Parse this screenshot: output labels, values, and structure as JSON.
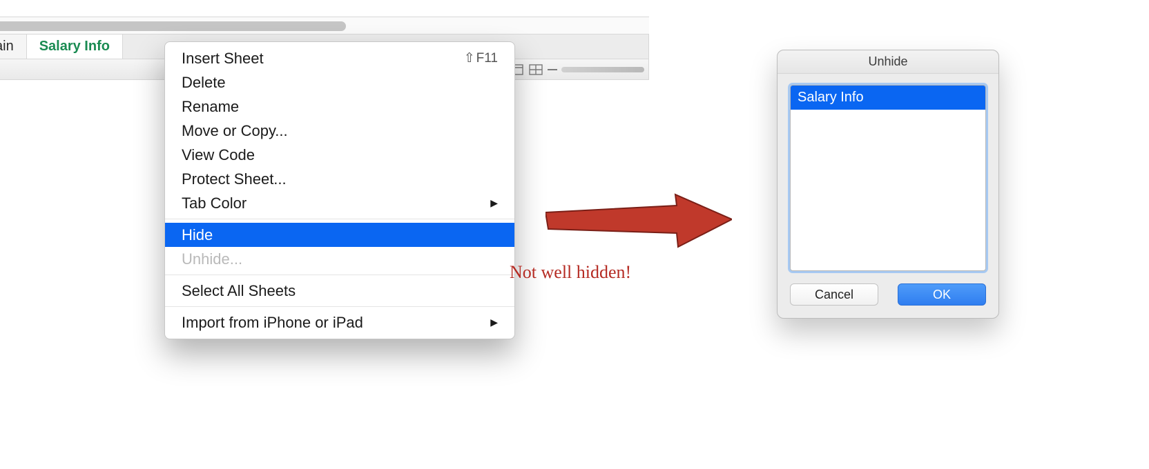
{
  "tabs": {
    "partial_label": "ain",
    "active_label": "Salary Info"
  },
  "context_menu": {
    "items": [
      {
        "label": "Insert Sheet",
        "shortcut": "F11",
        "shift": true
      },
      {
        "label": "Delete"
      },
      {
        "label": "Rename"
      },
      {
        "label": "Move or Copy..."
      },
      {
        "label": "View Code"
      },
      {
        "label": "Protect Sheet..."
      },
      {
        "label": "Tab Color",
        "submenu": true
      }
    ],
    "hide_label": "Hide",
    "unhide_label": "Unhide...",
    "select_all_label": "Select All Sheets",
    "import_label": "Import from iPhone or iPad"
  },
  "annotation": "Not well hidden!",
  "dialog": {
    "title": "Unhide",
    "list_items": [
      "Salary Info"
    ],
    "cancel_label": "Cancel",
    "ok_label": "OK"
  }
}
